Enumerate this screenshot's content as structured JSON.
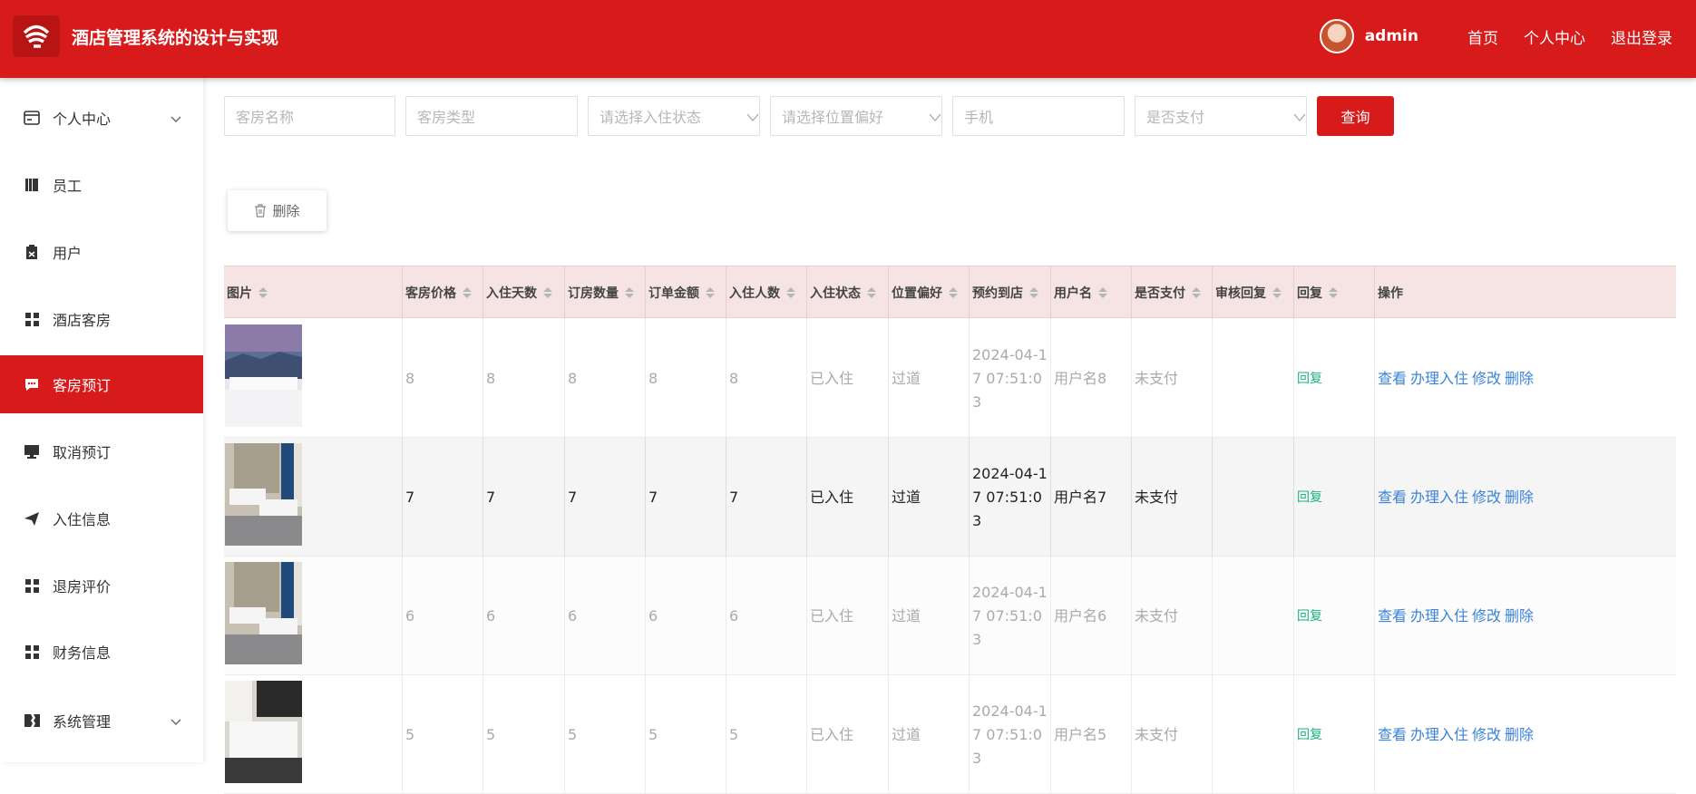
{
  "header": {
    "app_title": "酒店管理系统的设计与实现",
    "username": "admin",
    "links": [
      "首页",
      "个人中心",
      "退出登录"
    ]
  },
  "sidebar": {
    "items": [
      {
        "label": "个人中心",
        "icon": "id-card-icon",
        "has_arrow": true
      },
      {
        "label": "员工",
        "icon": "book-icon"
      },
      {
        "label": "用户",
        "icon": "clipboard-icon"
      },
      {
        "label": "酒店客房",
        "icon": "grid-icon"
      },
      {
        "label": "客房预订",
        "icon": "chat-icon",
        "active": true
      },
      {
        "label": "取消预订",
        "icon": "monitor-icon"
      },
      {
        "label": "入住信息",
        "icon": "send-icon"
      },
      {
        "label": "退房评价",
        "icon": "grid-icon"
      },
      {
        "label": "财务信息",
        "icon": "grid-icon"
      },
      {
        "label": "系统管理",
        "icon": "flag-icon",
        "has_arrow": true
      }
    ]
  },
  "filters": {
    "room_name": "客房名称",
    "room_type": "客房类型",
    "checkin_status": "请选择入住状态",
    "position_pref": "请选择位置偏好",
    "phone": "手机",
    "is_paid": "是否支付",
    "search_label": "查询"
  },
  "toolbar": {
    "delete_label": "删除"
  },
  "table": {
    "columns": [
      "图片",
      "客房价格",
      "入住天数",
      "订房数量",
      "订单金额",
      "入住人数",
      "入住状态",
      "位置偏好",
      "预约到店",
      "用户名",
      "是否支付",
      "审核回复",
      "回复",
      "操作"
    ],
    "rows": [
      {
        "price": "8",
        "days": "8",
        "count": "8",
        "amount": "8",
        "people": "8",
        "status": "已入住",
        "pref": "过道",
        "date": "2024-04-17 07:51:03",
        "user": "用户名8",
        "paid": "未支付",
        "review": "",
        "reply": "回复"
      },
      {
        "price": "7",
        "days": "7",
        "count": "7",
        "amount": "7",
        "people": "7",
        "status": "已入住",
        "pref": "过道",
        "date": "2024-04-17 07:51:03",
        "user": "用户名7",
        "paid": "未支付",
        "review": "",
        "reply": "回复"
      },
      {
        "price": "6",
        "days": "6",
        "count": "6",
        "amount": "6",
        "people": "6",
        "status": "已入住",
        "pref": "过道",
        "date": "2024-04-17 07:51:03",
        "user": "用户名6",
        "paid": "未支付",
        "review": "",
        "reply": "回复"
      },
      {
        "price": "5",
        "days": "5",
        "count": "5",
        "amount": "5",
        "people": "5",
        "status": "已入住",
        "pref": "过道",
        "date": "2024-04-17 07:51:03",
        "user": "用户名5",
        "paid": "未支付",
        "review": "",
        "reply": "回复"
      }
    ],
    "actions": [
      "查看",
      "办理入住",
      "修改",
      "删除"
    ]
  },
  "colors": {
    "brand": "#d71a1a",
    "header_row": "#f6e4e4",
    "link": "#3b84d9",
    "reply": "#19b37d"
  }
}
